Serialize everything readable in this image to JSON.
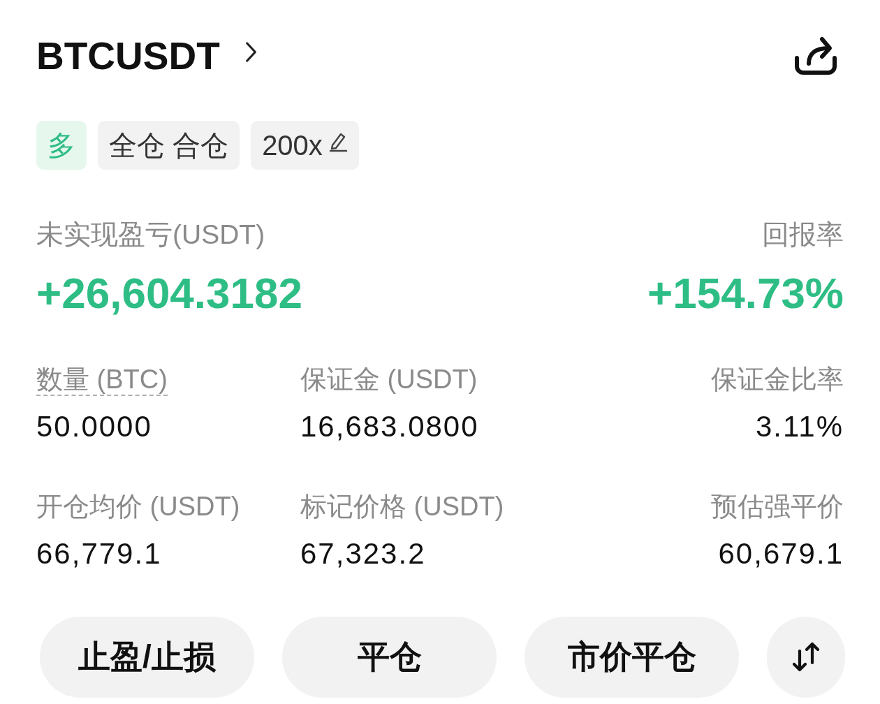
{
  "header": {
    "symbol": "BTCUSDT"
  },
  "tags": [
    {
      "kind": "side",
      "label": "多",
      "editable": false
    },
    {
      "kind": "mode",
      "label": "全仓 合仓",
      "editable": false
    },
    {
      "kind": "leverage",
      "label": "200x",
      "editable": true
    }
  ],
  "summary": [
    {
      "label": "未实现盈亏(USDT)",
      "value": "+26,604.3182"
    },
    {
      "label": "回报率",
      "value": "+154.73%"
    }
  ],
  "stats": [
    {
      "label": "数量 (BTC)",
      "value": "50.0000",
      "has_tooltip": true
    },
    {
      "label": "保证金 (USDT)",
      "value": "16,683.0800",
      "has_tooltip": false
    },
    {
      "label": "保证金比率",
      "value": "3.11%",
      "has_tooltip": false
    },
    {
      "label": "开仓均价 (USDT)",
      "value": "66,779.1",
      "has_tooltip": false
    },
    {
      "label": "标记价格 (USDT)",
      "value": "67,323.2",
      "has_tooltip": false
    },
    {
      "label": "预估强平价",
      "value": "60,679.1",
      "has_tooltip": false
    }
  ],
  "actions": [
    {
      "kind": "text",
      "label": "止盈/止损"
    },
    {
      "kind": "text",
      "label": "平仓"
    },
    {
      "kind": "text",
      "label": "市价平仓"
    },
    {
      "kind": "swap"
    }
  ]
}
